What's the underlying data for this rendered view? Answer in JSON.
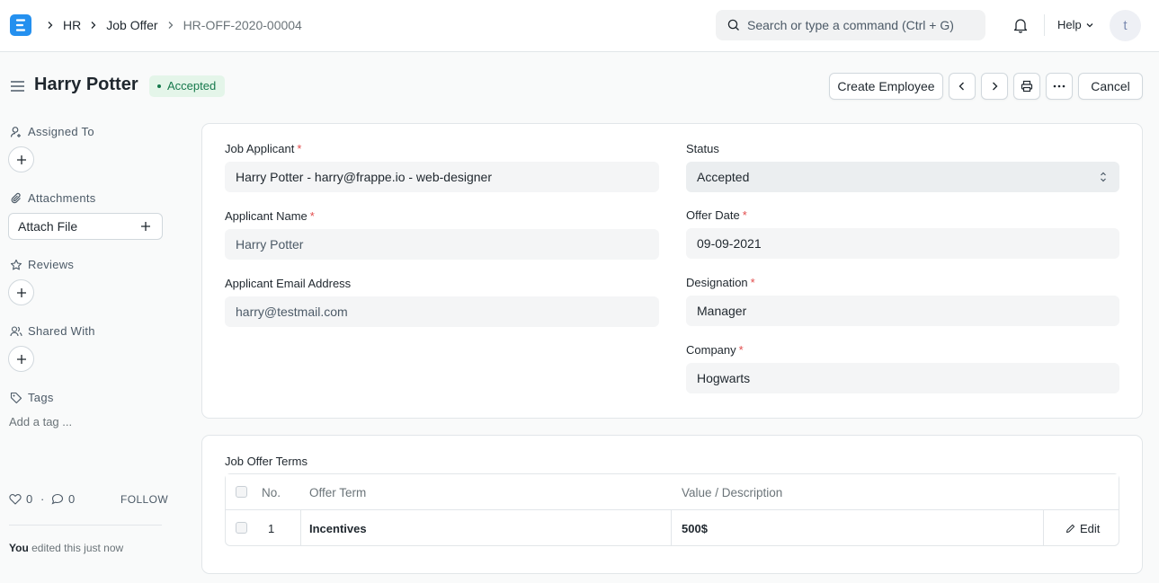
{
  "navbar": {
    "breadcrumbs": [
      "HR",
      "Job Offer",
      "HR-OFF-2020-00004"
    ],
    "search_placeholder": "Search or type a command (Ctrl + G)",
    "help_label": "Help",
    "avatar_initial": "t"
  },
  "page": {
    "title": "Harry Potter",
    "status": "Accepted",
    "actions": {
      "create_employee": "Create Employee",
      "cancel": "Cancel"
    }
  },
  "sidebar": {
    "assigned_to": "Assigned To",
    "attachments": "Attachments",
    "attach_file": "Attach File",
    "reviews": "Reviews",
    "shared_with": "Shared With",
    "tags": "Tags",
    "add_tag": "Add a tag ...",
    "likes": "0",
    "comments": "0",
    "follow": "FOLLOW",
    "activity_user": "You",
    "activity_text": " edited this just now"
  },
  "form": {
    "job_applicant": {
      "label": "Job Applicant",
      "value": "Harry Potter - harry@frappe.io - web-designer"
    },
    "applicant_name": {
      "label": "Applicant Name",
      "value": "Harry Potter"
    },
    "applicant_email": {
      "label": "Applicant Email Address",
      "value": "harry@testmail.com"
    },
    "status": {
      "label": "Status",
      "value": "Accepted"
    },
    "offer_date": {
      "label": "Offer Date",
      "value": "09-09-2021"
    },
    "designation": {
      "label": "Designation",
      "value": "Manager"
    },
    "company": {
      "label": "Company",
      "value": "Hogwarts"
    }
  },
  "terms": {
    "label": "Job Offer Terms",
    "columns": [
      "No.",
      "Offer Term",
      "Value / Description"
    ],
    "rows": [
      {
        "no": "1",
        "term": "Incentives",
        "value": "500$"
      }
    ],
    "edit_label": "Edit"
  },
  "colors": {
    "brand": "#2490ef",
    "status_bg": "#e4f5e9",
    "status_fg": "#16794c",
    "required": "#e24c4c"
  }
}
